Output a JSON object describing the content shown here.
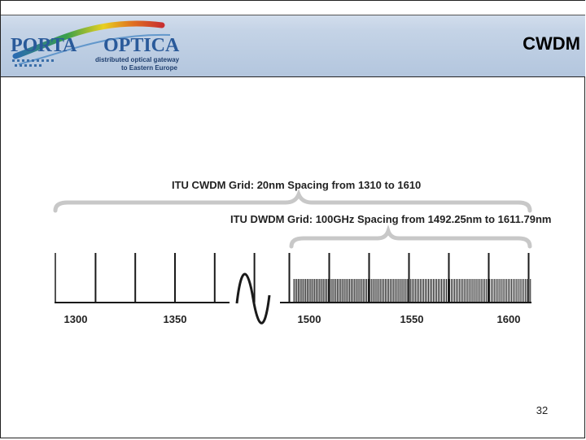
{
  "header": {
    "logo": {
      "name_left": "PORTA",
      "name_right": "OPTICA",
      "tagline_line1": "distributed optical gateway",
      "tagline_line2": "to Eastern Europe"
    },
    "title": "CWDM"
  },
  "diagram": {
    "cwdm_label": "ITU CWDM Grid: 20nm Spacing from 1310 to 1610",
    "dwdm_label": "ITU DWDM Grid: 100GHz Spacing from 1492.25nm to 1611.79nm",
    "axis_left_ticks": [
      "1300",
      "1350"
    ],
    "axis_right_ticks": [
      "1500",
      "1550",
      "1600"
    ],
    "cwdm_channels_left": [
      1310,
      1330,
      1350,
      1370,
      1390
    ],
    "cwdm_channels_right": [
      1490,
      1510,
      1530,
      1550,
      1570,
      1590,
      1610
    ],
    "dwdm_range_nm": [
      1492.25,
      1611.79
    ],
    "colors": {
      "line": "#1a1a1a",
      "brace": "#c8c8c8",
      "header_bg": "#c4d3e6"
    }
  },
  "footer": {
    "page_number": "32"
  }
}
